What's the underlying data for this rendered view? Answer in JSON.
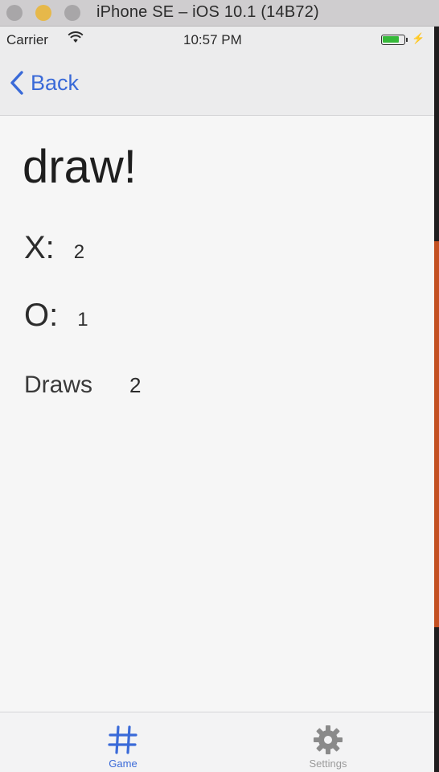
{
  "simulator": {
    "title": "iPhone SE – iOS 10.1 (14B72)"
  },
  "status_bar": {
    "carrier": "Carrier",
    "wifi_icon": "wifi-icon",
    "time": "10:57 PM",
    "battery_level": 0.85,
    "battery_color": "#36b93a",
    "charging_icon": "bolt-icon"
  },
  "nav": {
    "back_label": "Back",
    "accent": "#3a6ad8"
  },
  "game_result": {
    "title": "draw!",
    "x_label": "X:",
    "x_score": "2",
    "o_label": "O:",
    "o_score": "1",
    "draws_label": "Draws",
    "draws_count": "2"
  },
  "tab_bar": {
    "tabs": [
      {
        "label": "Game",
        "icon": "hash-icon",
        "selected": true
      },
      {
        "label": "Settings",
        "icon": "gear-icon",
        "selected": false
      }
    ]
  }
}
